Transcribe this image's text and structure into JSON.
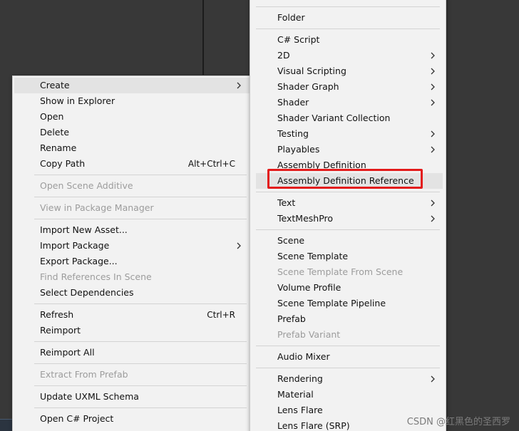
{
  "left_menu": {
    "create": "Create",
    "show_in_explorer": "Show in Explorer",
    "open": "Open",
    "delete": "Delete",
    "rename": "Rename",
    "copy_path": "Copy Path",
    "copy_path_shortcut": "Alt+Ctrl+C",
    "open_scene_additive": "Open Scene Additive",
    "view_in_package_manager": "View in Package Manager",
    "import_new_asset": "Import New Asset...",
    "import_package": "Import Package",
    "export_package": "Export Package...",
    "find_references_in_scene": "Find References In Scene",
    "select_dependencies": "Select Dependencies",
    "refresh": "Refresh",
    "refresh_shortcut": "Ctrl+R",
    "reimport": "Reimport",
    "reimport_all": "Reimport All",
    "extract_from_prefab": "Extract From Prefab",
    "update_uxml_schema": "Update UXML Schema",
    "open_csharp_project": "Open C# Project"
  },
  "right_menu": {
    "folder": "Folder",
    "csharp_script": "C# Script",
    "twod": "2D",
    "visual_scripting": "Visual Scripting",
    "shader_graph": "Shader Graph",
    "shader": "Shader",
    "shader_variant_collection": "Shader Variant Collection",
    "testing": "Testing",
    "playables": "Playables",
    "assembly_definition": "Assembly Definition",
    "assembly_definition_reference": "Assembly Definition Reference",
    "text": "Text",
    "textmeshpro": "TextMeshPro",
    "scene": "Scene",
    "scene_template": "Scene Template",
    "scene_template_from_scene": "Scene Template From Scene",
    "volume_profile": "Volume Profile",
    "scene_template_pipeline": "Scene Template Pipeline",
    "prefab": "Prefab",
    "prefab_variant": "Prefab Variant",
    "audio_mixer": "Audio Mixer",
    "rendering": "Rendering",
    "material": "Material",
    "lens_flare": "Lens Flare",
    "lens_flare_srp": "Lens Flare (SRP)"
  },
  "watermark": "CSDN @红黑色的圣西罗",
  "colors": {
    "highlight_box": "#e31b1b",
    "menu_bg": "#f2f2f2",
    "disabled_text": "#9c9c9c"
  }
}
